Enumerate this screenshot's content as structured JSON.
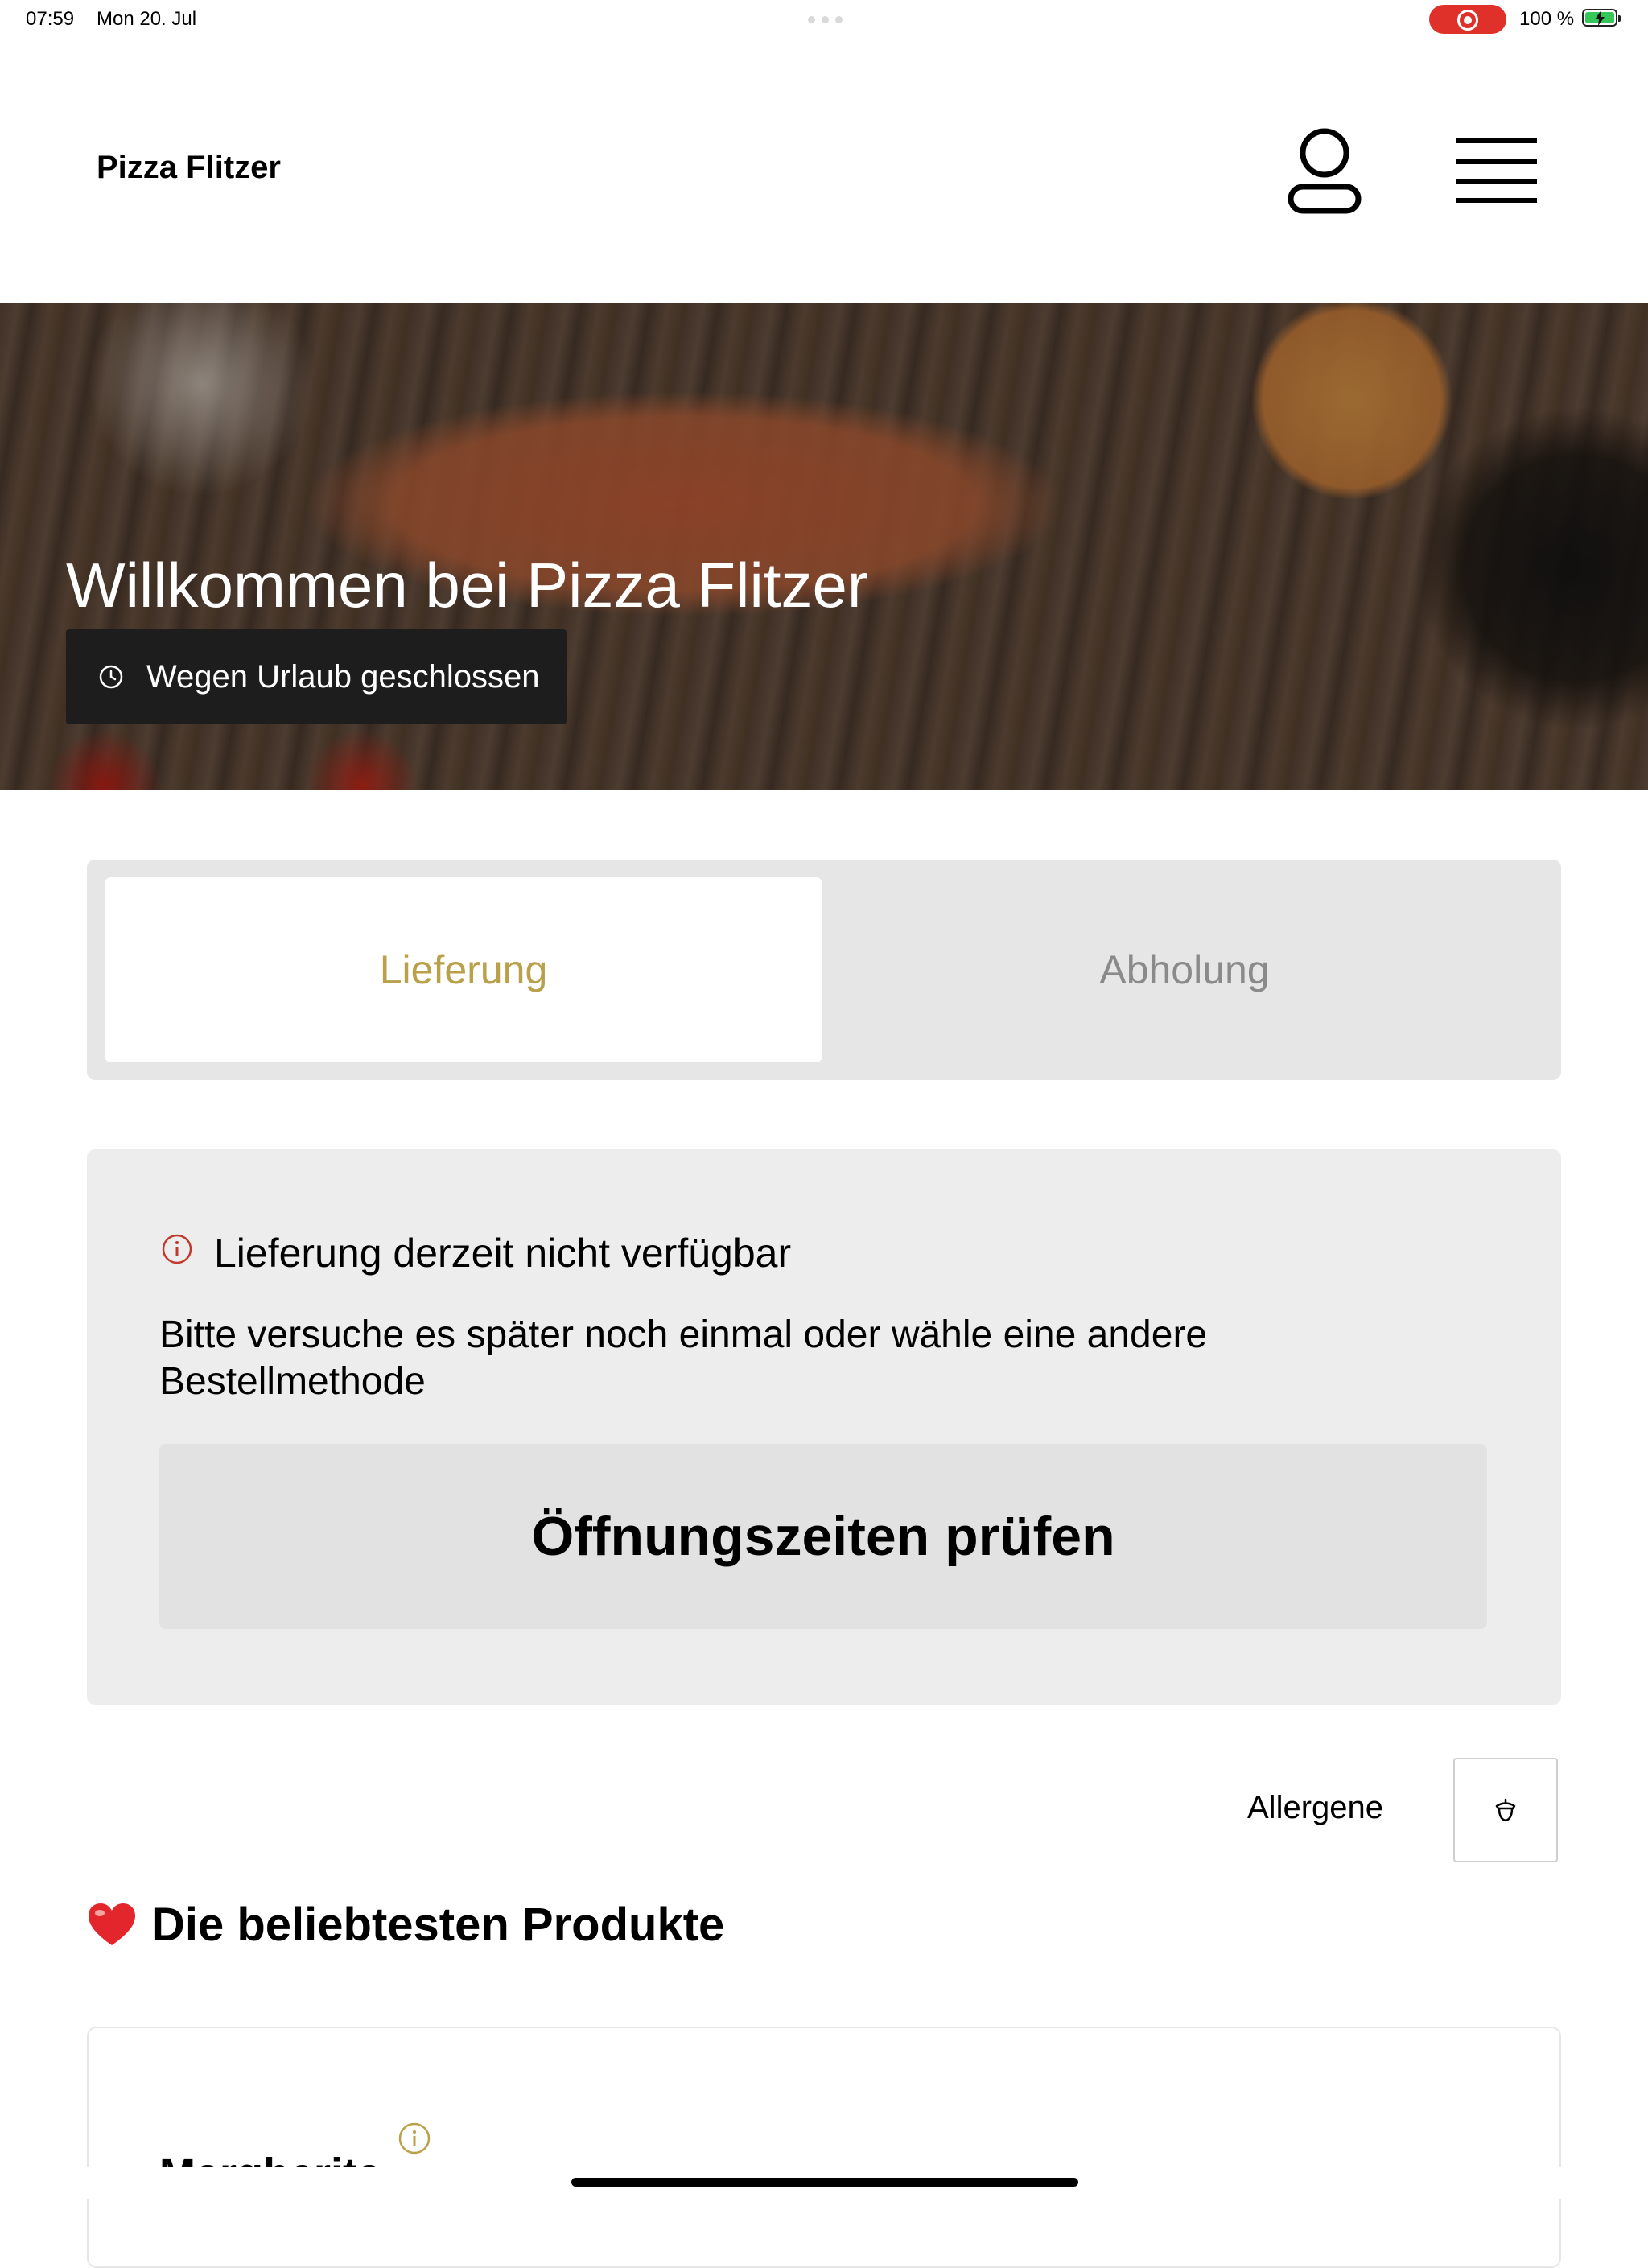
{
  "status_bar": {
    "time": "07:59",
    "date": "Mon 20. Jul",
    "battery": "100 %"
  },
  "header": {
    "brand": "Pizza Flitzer",
    "icons": [
      "account-icon",
      "menu-icon"
    ]
  },
  "hero": {
    "title": "Willkommen bei Pizza Flitzer",
    "status": "Wegen Urlaub geschlossen"
  },
  "tabs": [
    {
      "label": "Lieferung",
      "active": true
    },
    {
      "label": "Abholung",
      "active": false
    }
  ],
  "notice": {
    "title": "Lieferung derzeit nicht verfügbar",
    "text": "Bitte versuche es später noch einmal oder wähle eine andere Bestellmethode",
    "button": "Öffnungszeiten prüfen"
  },
  "allergens": {
    "label": "Allergene"
  },
  "popular": {
    "title": "Die beliebtesten Produkte",
    "products": [
      {
        "name": "Margherita"
      }
    ]
  },
  "colors": {
    "accent": "#b9a04a",
    "notice_icon": "#c0392b",
    "recording": "#e0302a"
  }
}
